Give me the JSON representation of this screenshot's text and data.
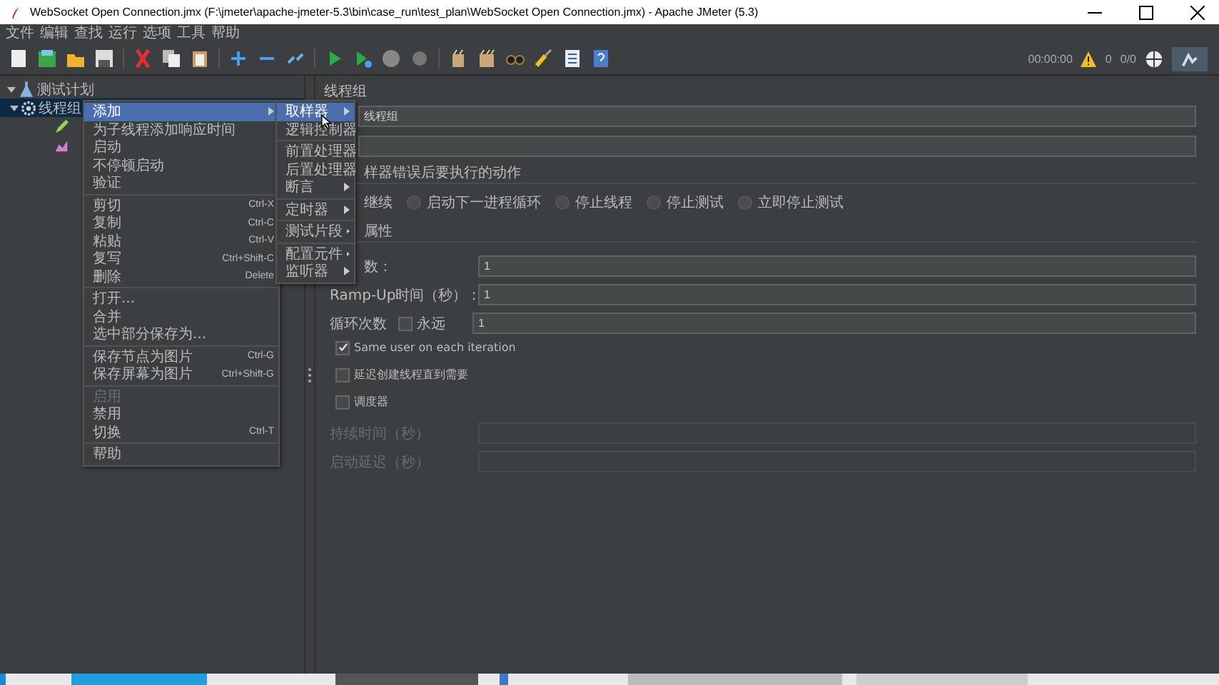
{
  "window": {
    "title": "WebSocket Open Connection.jmx (F:\\jmeter\\apache-jmeter-5.3\\bin\\case_run\\test_plan\\WebSocket Open Connection.jmx) - Apache JMeter (5.3)"
  },
  "menu_bar": [
    "文件",
    "编辑",
    "查找",
    "运行",
    "选项",
    "工具",
    "帮助"
  ],
  "toolbar": {
    "elapsed": "00:00:00",
    "warnings": "0",
    "threads": "0/0"
  },
  "tree": [
    {
      "label": "测试计划",
      "expanded": true,
      "selected": false,
      "children": [
        {
          "label": "线程组",
          "expanded": true,
          "selected": true,
          "children": [
            {
              "kind": "sampler"
            },
            {
              "kind": "listener"
            }
          ]
        }
      ]
    }
  ],
  "context_menu": [
    [
      {
        "label": "添加",
        "submenu": true,
        "selected": true,
        "disabled": false
      },
      {
        "label": "为子线程添加响应时间",
        "submenu": false,
        "selected": false,
        "disabled": false
      },
      {
        "label": "启动",
        "submenu": false,
        "selected": false,
        "disabled": false
      },
      {
        "label": "不停顿启动",
        "submenu": false,
        "selected": false,
        "disabled": false
      },
      {
        "label": "验证",
        "submenu": false,
        "selected": false,
        "disabled": false
      }
    ],
    [
      {
        "label": "剪切",
        "shortcut": "Ctrl-X",
        "submenu": false,
        "selected": false,
        "disabled": false
      },
      {
        "label": "复制",
        "shortcut": "Ctrl-C",
        "submenu": false,
        "selected": false,
        "disabled": false
      },
      {
        "label": "粘贴",
        "shortcut": "Ctrl-V",
        "submenu": false,
        "selected": false,
        "disabled": false
      },
      {
        "label": "复写",
        "shortcut": "Ctrl+Shift-C",
        "submenu": false,
        "selected": false,
        "disabled": false
      },
      {
        "label": "删除",
        "shortcut": "Delete",
        "submenu": false,
        "selected": false,
        "disabled": false
      }
    ],
    [
      {
        "label": "打开...",
        "submenu": false,
        "selected": false,
        "disabled": false
      },
      {
        "label": "合并",
        "submenu": false,
        "selected": false,
        "disabled": false
      },
      {
        "label": "选中部分保存为...",
        "submenu": false,
        "selected": false,
        "disabled": false
      }
    ],
    [
      {
        "label": "保存节点为图片",
        "shortcut": "Ctrl-G",
        "submenu": false,
        "selected": false,
        "disabled": false
      },
      {
        "label": "保存屏幕为图片",
        "shortcut": "Ctrl+Shift-G",
        "submenu": false,
        "selected": false,
        "disabled": false
      }
    ],
    [
      {
        "label": "启用",
        "submenu": false,
        "selected": false,
        "disabled": true
      },
      {
        "label": "禁用",
        "submenu": false,
        "selected": false,
        "disabled": false
      },
      {
        "label": "切换",
        "shortcut": "Ctrl-T",
        "submenu": false,
        "selected": false,
        "disabled": false
      }
    ],
    [
      {
        "label": "帮助",
        "submenu": false,
        "selected": false,
        "disabled": false
      }
    ]
  ],
  "add_submenu": [
    [
      {
        "label": "取样器",
        "selected": true
      },
      {
        "label": "逻辑控制器",
        "selected": false
      }
    ],
    [
      {
        "label": "前置处理器",
        "selected": false
      },
      {
        "label": "后置处理器",
        "selected": false
      },
      {
        "label": "断言",
        "selected": false
      }
    ],
    [
      {
        "label": "定时器",
        "selected": false
      }
    ],
    [
      {
        "label": "测试片段",
        "selected": false
      }
    ],
    [
      {
        "label": "配置元件",
        "selected": false
      },
      {
        "label": "监听器",
        "selected": false
      }
    ]
  ],
  "editor": {
    "title": "线程组",
    "name_value": "线程组",
    "error_action": {
      "caption": "样器错误后要执行的动作",
      "options": [
        {
          "label": "继续",
          "kind": "covered"
        },
        {
          "label": "启动下一进程循环",
          "kind": "radio",
          "selected": false
        },
        {
          "label": "停止线程",
          "kind": "radio",
          "selected": false
        },
        {
          "label": "停止测试",
          "kind": "radio",
          "selected": false
        },
        {
          "label": "立即停止测试",
          "kind": "radio",
          "selected": false
        }
      ]
    },
    "properties": {
      "caption": "属性",
      "fields": [
        {
          "label": "数：",
          "value": "1"
        },
        {
          "label": "Ramp-Up时间（秒）：",
          "value": "1"
        }
      ],
      "loop": {
        "label": "循环次数",
        "forever_label": "永远",
        "forever_checked": false,
        "value": "1"
      },
      "checkboxes": [
        {
          "label": "Same user on each iteration",
          "checked": true
        },
        {
          "label": "延迟创建线程直到需要",
          "checked": false
        },
        {
          "label": "调度器",
          "checked": false
        }
      ],
      "scheduler_fields": [
        {
          "label": "持续时间（秒）",
          "disabled": true
        },
        {
          "label": "启动延迟（秒）",
          "disabled": true
        }
      ]
    }
  }
}
